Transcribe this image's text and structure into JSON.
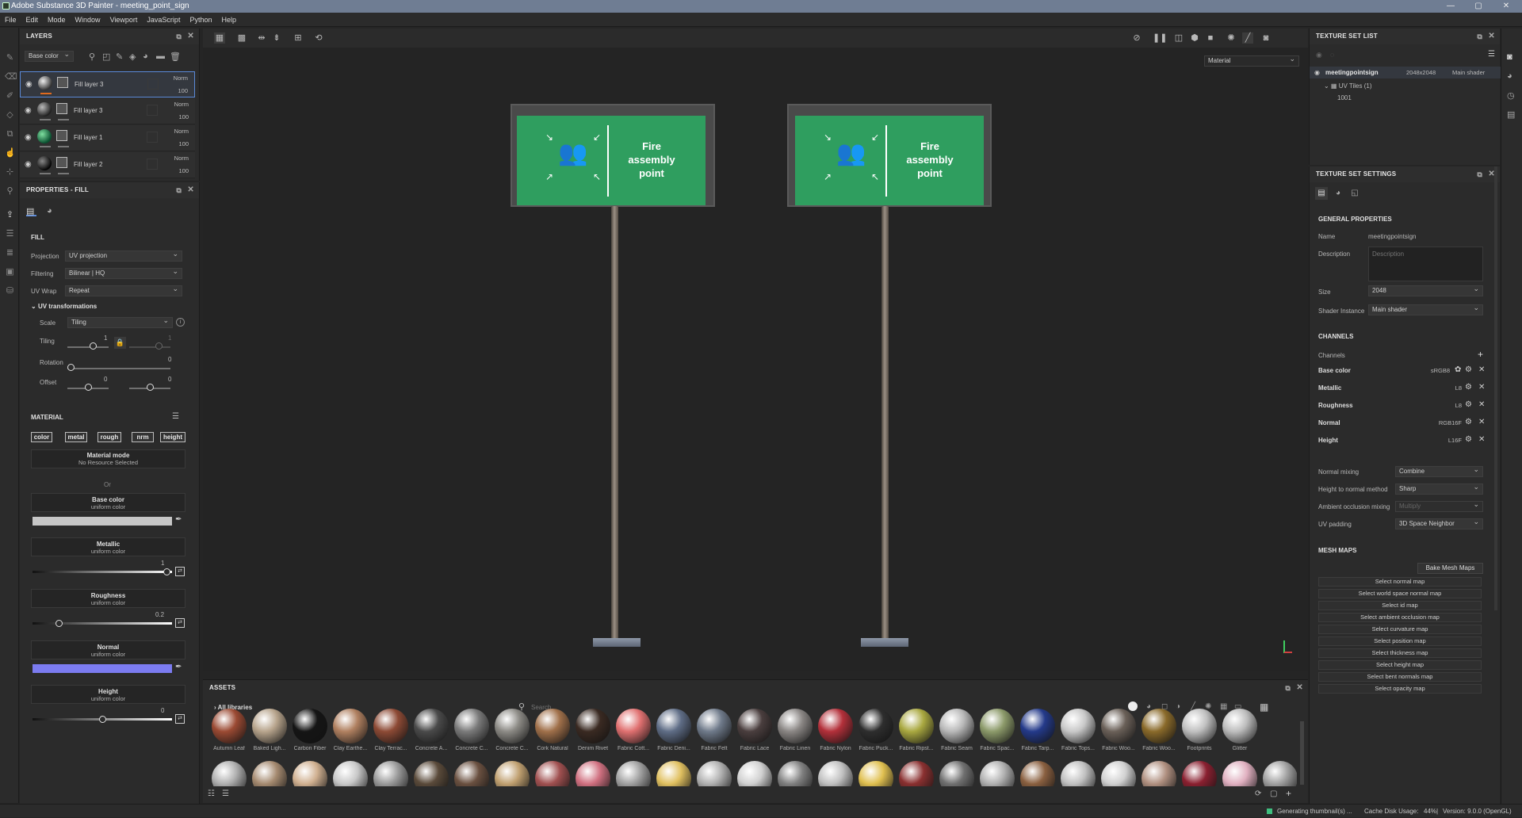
{
  "window": {
    "title": "Adobe Substance 3D Painter - meeting_point_sign",
    "controls": [
      "—",
      "▢",
      "✕"
    ]
  },
  "menu": [
    "File",
    "Edit",
    "Mode",
    "Window",
    "Viewport",
    "JavaScript",
    "Python",
    "Help"
  ],
  "layers": {
    "title": "LAYERS",
    "channel": "Base color",
    "rows": [
      {
        "name": "Fill layer 3",
        "blend": "Norm",
        "opacity": "100",
        "selected": true
      },
      {
        "name": "Fill layer 3",
        "blend": "Norm",
        "opacity": "100",
        "selected": false
      },
      {
        "name": "Fill layer 1",
        "blend": "Norm",
        "opacity": "100",
        "selected": false
      },
      {
        "name": "Fill layer 2",
        "blend": "Norm",
        "opacity": "100",
        "selected": false
      }
    ]
  },
  "properties": {
    "title": "PROPERTIES - FILL",
    "fill_label": "FILL",
    "projection_label": "Projection",
    "projection": "UV projection",
    "filtering_label": "Filtering",
    "filtering": "Bilinear | HQ",
    "uvwrap_label": "UV Wrap",
    "uvwrap": "Repeat",
    "uvtrans_label": "UV transformations",
    "scale_label": "Scale",
    "scale": "Tiling",
    "tiling_label": "Tiling",
    "tiling_a": "1",
    "tiling_b": "1",
    "rotation_label": "Rotation",
    "rotation": "0",
    "offset_label": "Offset",
    "offset_a": "0",
    "offset_b": "0",
    "material_label": "MATERIAL",
    "chips": [
      "color",
      "metal",
      "rough",
      "nrm",
      "height"
    ],
    "material_mode": "Material mode",
    "no_resource": "No Resource Selected",
    "or": "Or",
    "base_color": "Base color",
    "uniform": "uniform color",
    "metallic": "Metallic",
    "metallic_val": "1",
    "roughness": "Roughness",
    "roughness_val": "0.2",
    "normal": "Normal",
    "height": "Height",
    "height_val": "0"
  },
  "viewport": {
    "mode": "Material",
    "sign_text_1": "Fire",
    "sign_text_2": "assembly",
    "sign_text_3": "point"
  },
  "assets": {
    "title": "ASSETS",
    "library": "All libraries",
    "search_placeholder": "Search",
    "items": [
      {
        "name": "Autumn Leaf",
        "color": "#9b4a33"
      },
      {
        "name": "Baked Ligh...",
        "color": "#b7a48c"
      },
      {
        "name": "Carbon Fiber",
        "color": "#151515"
      },
      {
        "name": "Clay Earthe...",
        "color": "#b08060"
      },
      {
        "name": "Clay Terrac...",
        "color": "#8d4a35"
      },
      {
        "name": "Concrete A...",
        "color": "#4a4a4a"
      },
      {
        "name": "Concrete C...",
        "color": "#7a7a7a"
      },
      {
        "name": "Concrete C...",
        "color": "#8c8a85"
      },
      {
        "name": "Cork Natural",
        "color": "#a0704a"
      },
      {
        "name": "Denim Rivet",
        "color": "#3a2a22"
      },
      {
        "name": "Fabric Cott...",
        "color": "#e07070"
      },
      {
        "name": "Fabric Deni...",
        "color": "#5f6d86"
      },
      {
        "name": "Fabric Felt",
        "color": "#6f7a8a"
      },
      {
        "name": "Fabric Lace",
        "color": "#4a3e3e"
      },
      {
        "name": "Fabric Linen",
        "color": "#8a8684"
      },
      {
        "name": "Fabric Nylon",
        "color": "#b3303a"
      },
      {
        "name": "Fabric Puck...",
        "color": "#2e2e2e"
      },
      {
        "name": "Fabric Ripst...",
        "color": "#a9a840"
      },
      {
        "name": "Fabric Seam",
        "color": "#b8b8b8"
      },
      {
        "name": "Fabric Spac...",
        "color": "#8c9a6a"
      },
      {
        "name": "Fabric Tarp...",
        "color": "#243a8a"
      },
      {
        "name": "Fabric Tops...",
        "color": "#c8c8c8"
      },
      {
        "name": "Fabric Woo...",
        "color": "#6a6058"
      },
      {
        "name": "Fabric Woo...",
        "color": "#8a6a2a"
      },
      {
        "name": "Footprints",
        "color": "#c0c0c0"
      },
      {
        "name": "Glitter",
        "color": "#bdbdbd"
      }
    ],
    "row2_colors": [
      "#b0b0b0",
      "#a58a70",
      "#d0b090",
      "#c8c8c8",
      "#9a9a9a",
      "#5a4a3a",
      "#6a5040",
      "#c0a070",
      "#a05050",
      "#d07080",
      "#a0a0a0",
      "#e0c060",
      "#b0b0b0",
      "#d0d0d0",
      "#808080",
      "#c0c0c0",
      "#e0c050",
      "#8a3030",
      "#707070",
      "#b0b0b0",
      "#8a6040",
      "#c0c0c0",
      "#d0d0d0",
      "#b09080",
      "#8a2030",
      "#e0b0c0",
      "#a0a0a0",
      "#e06080",
      "#c0c0c0"
    ]
  },
  "texture_set_list": {
    "title": "TEXTURE SET LIST",
    "set_name": "meetingpointsign",
    "set_size": "2048x2048",
    "set_shader": "Main shader",
    "uv_tiles": "UV Tiles (1)",
    "tile": "1001"
  },
  "texture_set_settings": {
    "title": "TEXTURE SET SETTINGS",
    "general": "GENERAL PROPERTIES",
    "name_label": "Name",
    "name": "meetingpointsign",
    "desc_label": "Description",
    "desc_placeholder": "Description",
    "size_label": "Size",
    "size": "2048",
    "shader_label": "Shader Instance",
    "shader": "Main shader",
    "channels_title": "CHANNELS",
    "channels_label": "Channels",
    "channels": [
      {
        "name": "Base color",
        "format": "sRGB8"
      },
      {
        "name": "Metallic",
        "format": "L8"
      },
      {
        "name": "Roughness",
        "format": "L8"
      },
      {
        "name": "Normal",
        "format": "RGB16F"
      },
      {
        "name": "Height",
        "format": "L16F"
      }
    ],
    "normal_mixing_label": "Normal mixing",
    "normal_mixing": "Combine",
    "h2n_label": "Height to normal method",
    "h2n": "Sharp",
    "ao_label": "Ambient occlusion mixing",
    "ao": "Multiply",
    "uvpad_label": "UV padding",
    "uvpad": "3D Space Neighbor",
    "mesh_maps_title": "MESH MAPS",
    "bake_button": "Bake Mesh Maps",
    "maps": [
      "Select normal map",
      "Select world space normal map",
      "Select id map",
      "Select ambient occlusion map",
      "Select curvature map",
      "Select position map",
      "Select thickness map",
      "Select height map",
      "Select bent normals map",
      "Select opacity map"
    ]
  },
  "status": {
    "generating": "Generating thumbnail(s) ...",
    "cache": "Cache Disk Usage:",
    "cache_val": "44%",
    "version": "Version: 9.0.0 (OpenGL)"
  },
  "colors": {
    "accent": "#5b8ad8",
    "sign_green": "#2f9e5f",
    "normal_color": "#7b7bf0"
  }
}
